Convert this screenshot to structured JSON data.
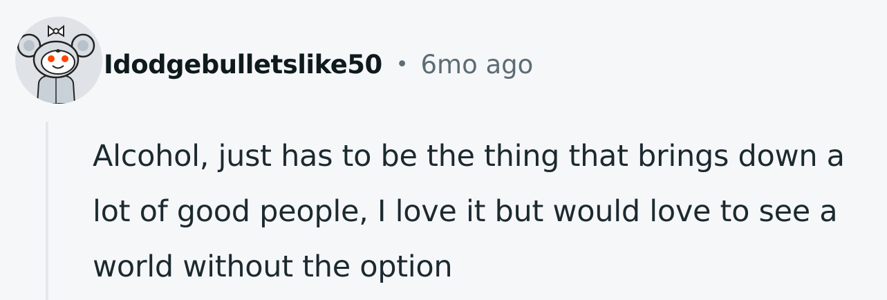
{
  "comment": {
    "author": {
      "username": "Idodgebulletslike50",
      "avatar_icon": "snoo-koala-avatar-icon"
    },
    "separator": "•",
    "timestamp": "6mo ago",
    "body": "Alcohol, just has to be the thing that brings down a lot of good people, I love it but would love to see a world without the option"
  },
  "colors": {
    "background": "#f6f7f9",
    "username": "#0f1a1c",
    "meta": "#5c6c74",
    "body": "#1c2a30",
    "thread_line": "#e4e8ec",
    "avatar_bg": "#dfe3e8"
  }
}
